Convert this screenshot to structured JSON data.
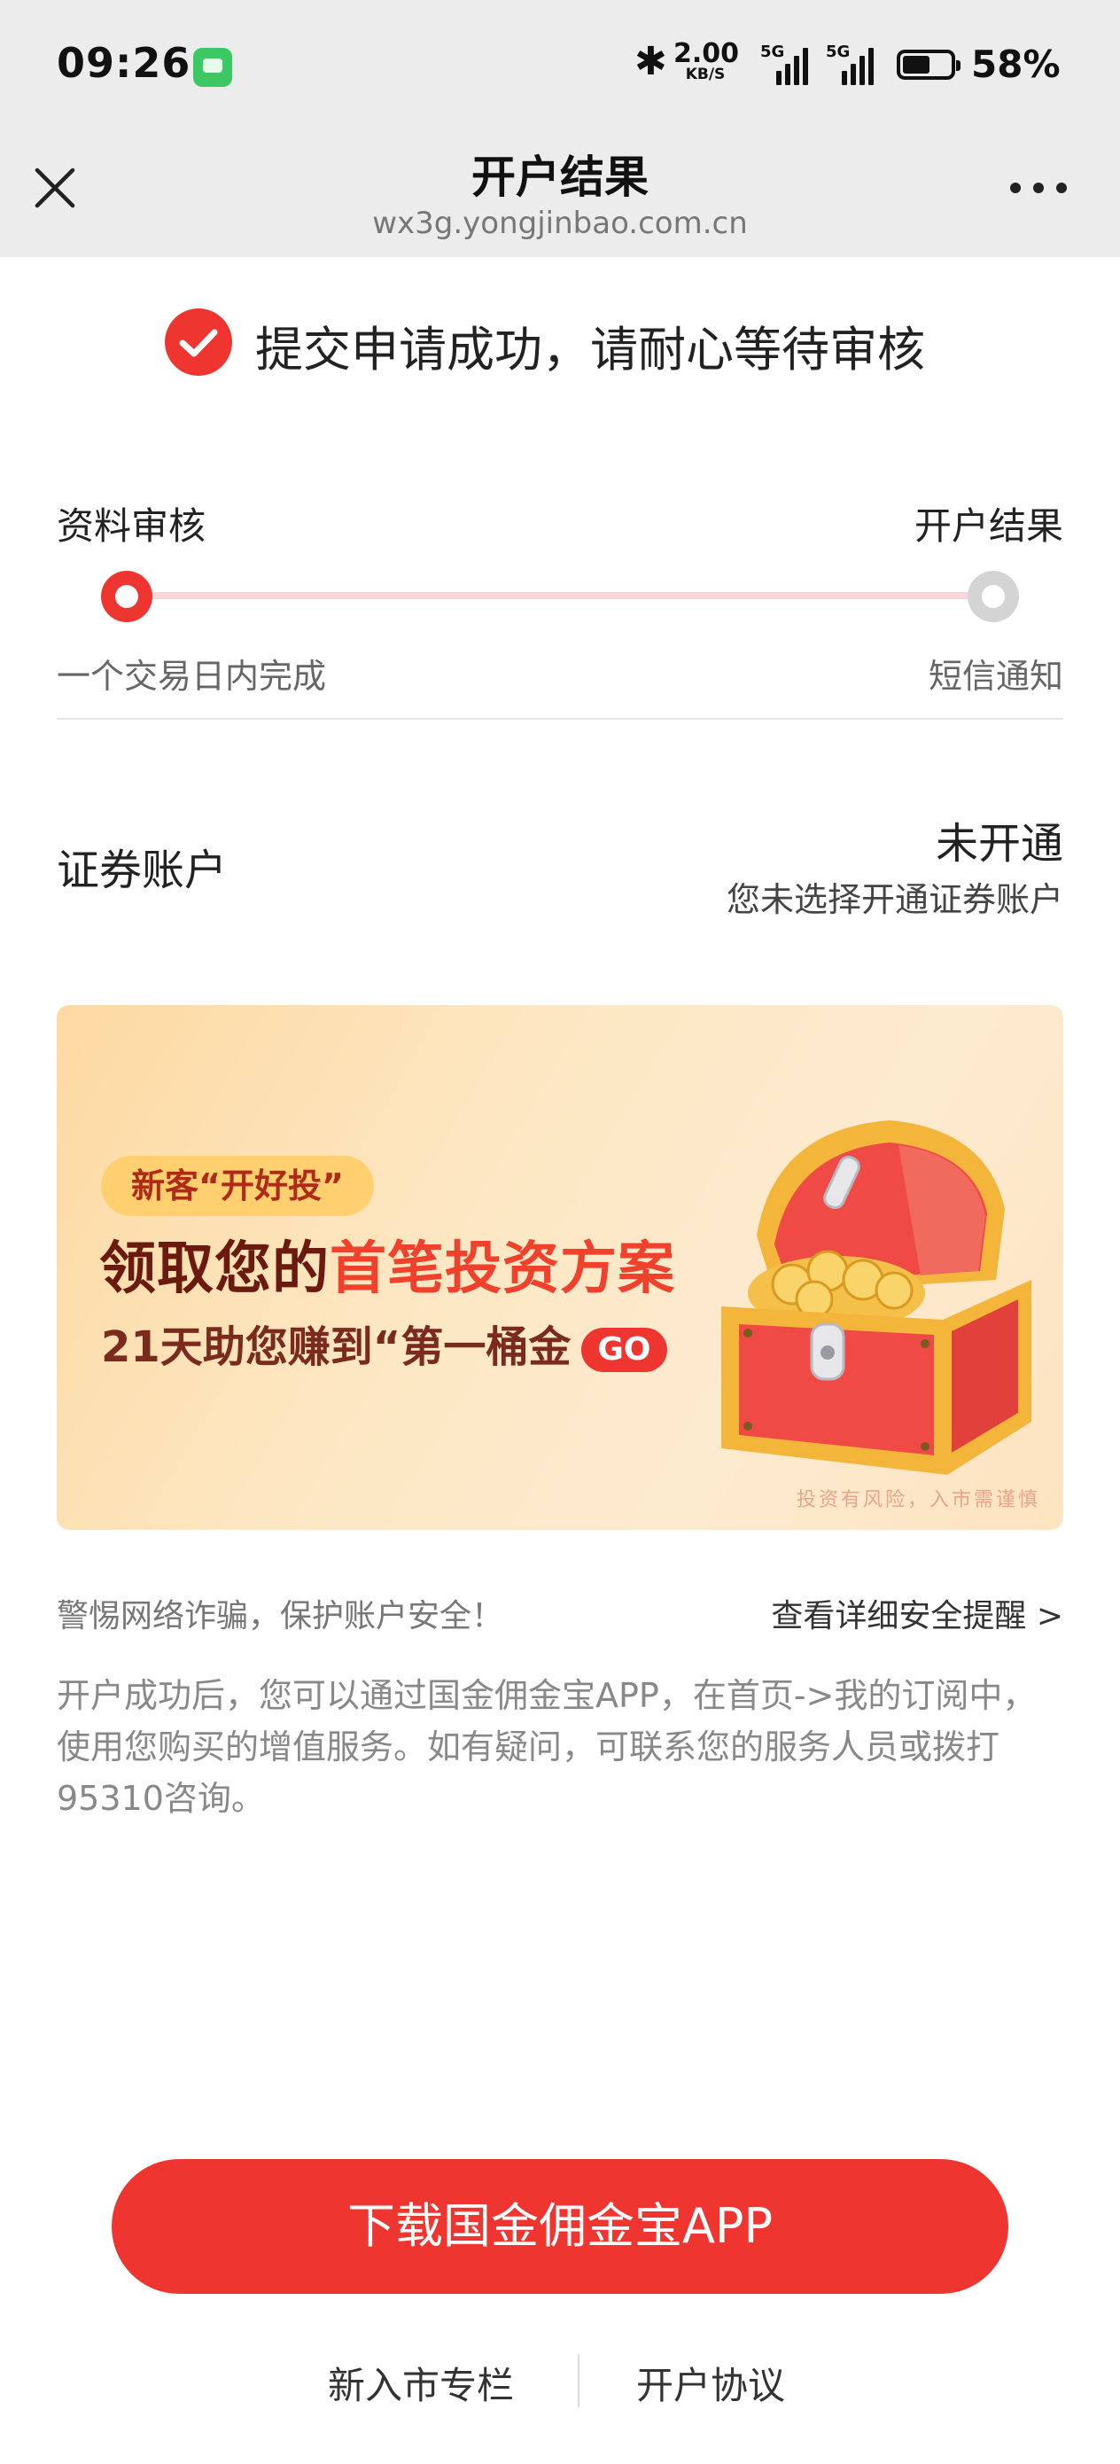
{
  "status_bar": {
    "time": "09:26",
    "net_rate_value": "2.00",
    "net_rate_unit": "KB/S",
    "sim1_label": "5G",
    "sim2_label": "5G",
    "battery_level": 0.58,
    "battery_text": "58%"
  },
  "nav": {
    "title": "开户结果",
    "url": "wx3g.yongjinbao.com.cn"
  },
  "result": {
    "message": "提交申请成功，请耐心等待审核",
    "accent_color": "#ef3530"
  },
  "progress": {
    "step1_title": "资料审核",
    "step1_desc": "一个交易日内完成",
    "step2_title": "开户结果",
    "step2_desc": "短信通知"
  },
  "account": {
    "label": "证券账户",
    "status": "未开通",
    "note": "您未选择开通证券账户"
  },
  "banner": {
    "tag": "新客“开好投”",
    "headline_part1": "领取您的",
    "headline_part2": "首笔投资方案",
    "subline": "21天助您赚到“第一桶金",
    "go": "GO",
    "risk": "投资有风险，入市需谨慎"
  },
  "notice": {
    "warning": "警惕网络诈骗，保护账户安全！",
    "link": "查看详细安全提醒 >",
    "paragraph": "开户成功后，您可以通过国金佣金宝APP，在首页->我的订阅中，使用您购买的增值服务。如有疑问，可联系您的服务人员或拨打95310咨询。"
  },
  "footer": {
    "download_button": "下载国金佣金宝APP",
    "link1": "新入市专栏",
    "link2": "开户协议"
  }
}
